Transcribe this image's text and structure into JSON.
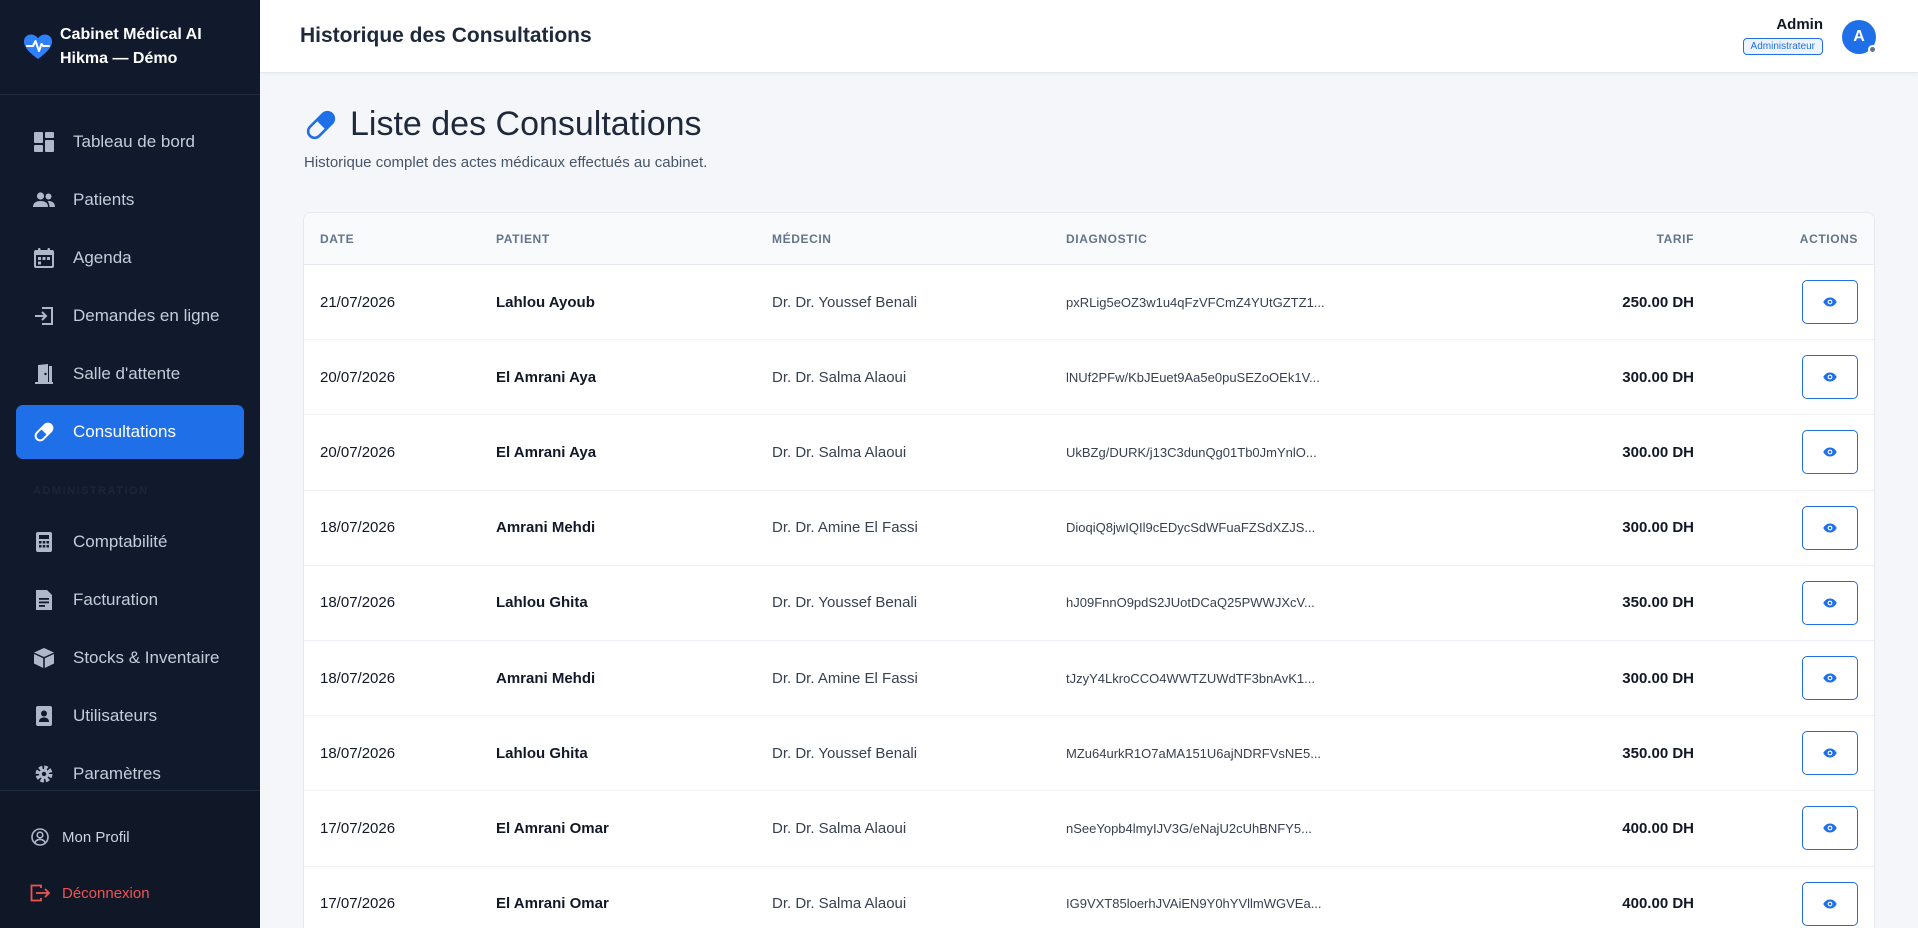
{
  "app": {
    "brand_line1": "Cabinet Médical AI",
    "brand_line2": "Hikma — Démo",
    "accent_color": "#1f6fe8",
    "sidebar_color": "#111a2d"
  },
  "sidebar": {
    "items": [
      {
        "label": "Tableau de bord",
        "icon": "dashboard-icon"
      },
      {
        "label": "Patients",
        "icon": "users-icon"
      },
      {
        "label": "Agenda",
        "icon": "calendar-icon"
      },
      {
        "label": "Demandes en ligne",
        "icon": "login-icon"
      },
      {
        "label": "Salle d'attente",
        "icon": "door-icon"
      },
      {
        "label": "Consultations",
        "icon": "pill-icon",
        "active": true
      }
    ],
    "section_label": "ADMINISTRATION",
    "admin_items": [
      {
        "label": "Comptabilité",
        "icon": "calculator-icon"
      },
      {
        "label": "Facturation",
        "icon": "invoice-icon"
      },
      {
        "label": "Stocks & Inventaire",
        "icon": "box-icon"
      },
      {
        "label": "Utilisateurs",
        "icon": "user-badge-icon"
      },
      {
        "label": "Paramètres",
        "icon": "gear-icon"
      }
    ],
    "profile_label": "Mon Profil",
    "logout_label": "Déconnexion"
  },
  "header": {
    "title": "Historique des Consultations",
    "user_name": "Admin",
    "user_role": "Administrateur",
    "avatar_initial": "A"
  },
  "main": {
    "title": "Liste des Consultations",
    "subtitle": "Historique complet des actes médicaux effectués au cabinet."
  },
  "table": {
    "columns": {
      "date": "DATE",
      "patient": "PATIENT",
      "medecin": "MÉDECIN",
      "diagnostic": "DIAGNOSTIC",
      "tarif": "TARIF",
      "actions": "ACTIONS"
    },
    "rows": [
      {
        "date": "21/07/2026",
        "patient": "Lahlou Ayoub",
        "medecin": "Dr. Dr. Youssef Benali",
        "diagnostic": "pxRLig5eOZ3w1u4qFzVFCmZ4YUtGZTZ1...",
        "tarif": "250.00 DH"
      },
      {
        "date": "20/07/2026",
        "patient": "El Amrani Aya",
        "medecin": "Dr. Dr. Salma Alaoui",
        "diagnostic": "lNUf2PFw/KbJEuet9Aa5e0puSEZoOEk1V...",
        "tarif": "300.00 DH"
      },
      {
        "date": "20/07/2026",
        "patient": "El Amrani Aya",
        "medecin": "Dr. Dr. Salma Alaoui",
        "diagnostic": "UkBZg/DURK/j13C3dunQg01Tb0JmYnlO...",
        "tarif": "300.00 DH"
      },
      {
        "date": "18/07/2026",
        "patient": "Amrani Mehdi",
        "medecin": "Dr. Dr. Amine El Fassi",
        "diagnostic": "DioqiQ8jwIQIl9cEDycSdWFuaFZSdXZJS...",
        "tarif": "300.00 DH"
      },
      {
        "date": "18/07/2026",
        "patient": "Lahlou Ghita",
        "medecin": "Dr. Dr. Youssef Benali",
        "diagnostic": "hJ09FnnO9pdS2JUotDCaQ25PWWJXcV...",
        "tarif": "350.00 DH"
      },
      {
        "date": "18/07/2026",
        "patient": "Amrani Mehdi",
        "medecin": "Dr. Dr. Amine El Fassi",
        "diagnostic": "tJzyY4LkroCCO4WWTZUWdTF3bnAvK1...",
        "tarif": "300.00 DH"
      },
      {
        "date": "18/07/2026",
        "patient": "Lahlou Ghita",
        "medecin": "Dr. Dr. Youssef Benali",
        "diagnostic": "MZu64urkR1O7aMA151U6ajNDRFVsNE5...",
        "tarif": "350.00 DH"
      },
      {
        "date": "17/07/2026",
        "patient": "El Amrani Omar",
        "medecin": "Dr. Dr. Salma Alaoui",
        "diagnostic": "nSeeYopb4lmyIJV3G/eNajU2cUhBNFY5...",
        "tarif": "400.00 DH"
      },
      {
        "date": "17/07/2026",
        "patient": "El Amrani Omar",
        "medecin": "Dr. Dr. Salma Alaoui",
        "diagnostic": "IG9VXT85loerhJVAiEN9Y0hYVllmWGVEa...",
        "tarif": "400.00 DH"
      }
    ]
  }
}
